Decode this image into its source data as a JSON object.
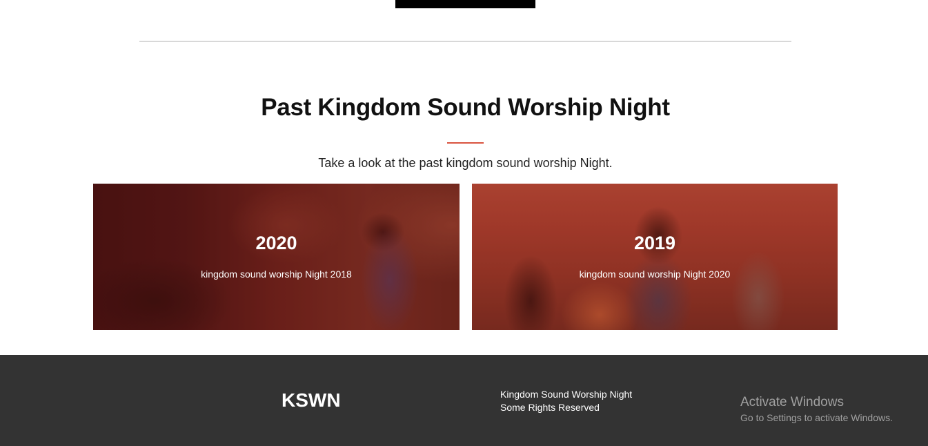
{
  "section": {
    "title": "Past Kingdom Sound Worship Night",
    "subtitle": "Take a look at the past kingdom sound worship Night."
  },
  "cards": [
    {
      "year": "2020",
      "caption": "kingdom sound worship Night 2018"
    },
    {
      "year": "2019",
      "caption": "kingdom sound worship Night 2020"
    }
  ],
  "footer": {
    "brand": "KSWN",
    "line1": "Kingdom Sound Worship Night",
    "line2": "Some Rights Reserved"
  },
  "os_watermark": {
    "title": "Activate Windows",
    "subtitle": "Go to Settings to activate Windows."
  },
  "colors": {
    "accent": "#d9533f",
    "footer_bg": "#333333"
  }
}
